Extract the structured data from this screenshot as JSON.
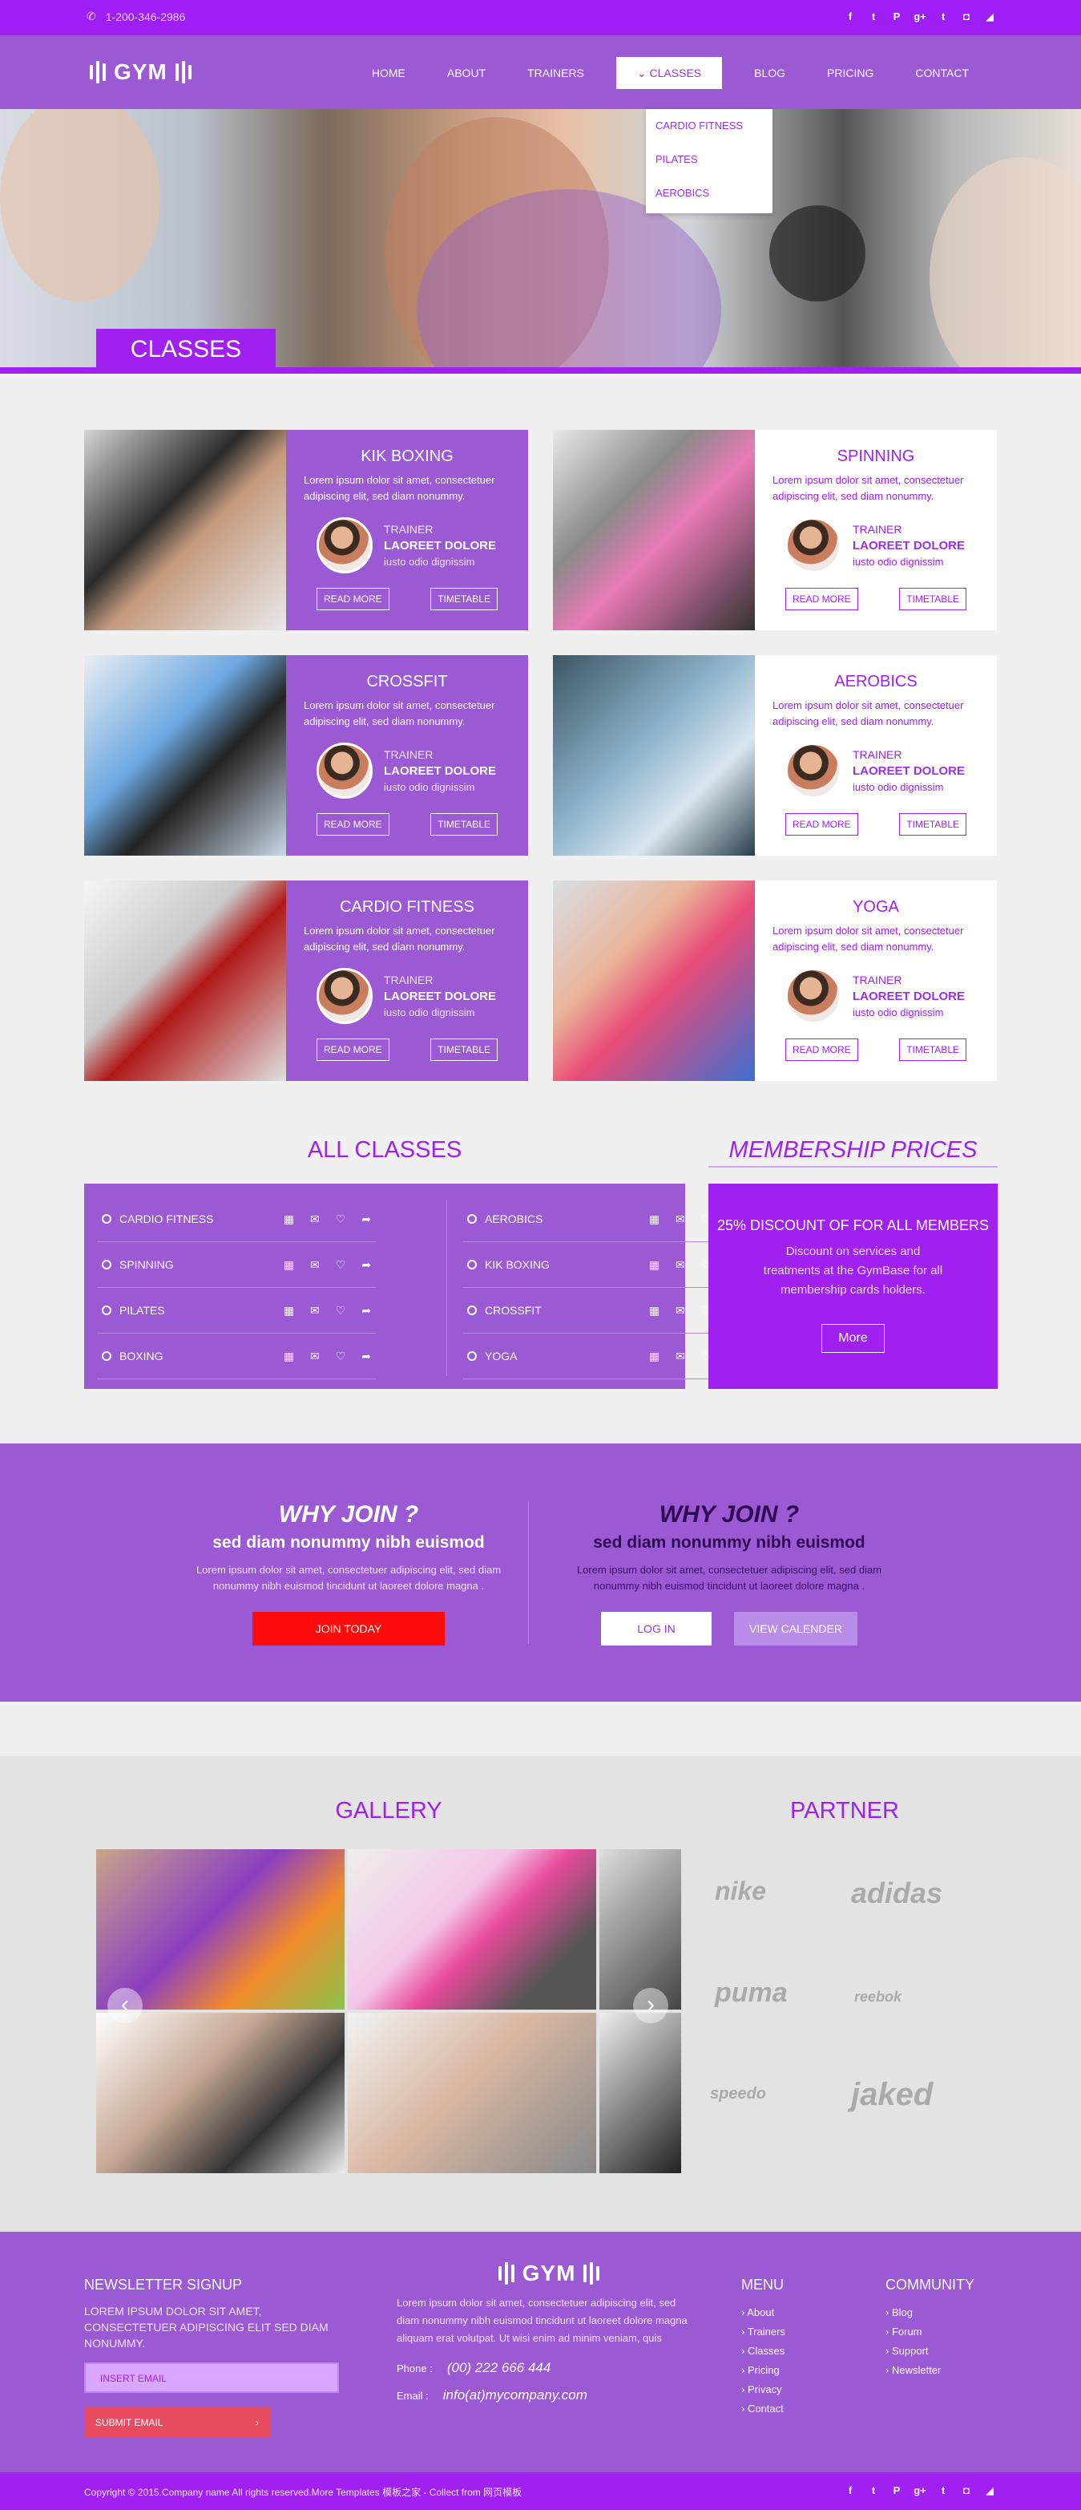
{
  "topbar": {
    "phone": "1-200-346-2986"
  },
  "social_icons": [
    "facebook-icon",
    "twitter-icon",
    "pinterest-icon",
    "google-plus-icon",
    "tumblr-icon",
    "instagram-icon",
    "rss-icon"
  ],
  "social_glyphs": [
    "f",
    "t",
    "P",
    "g+",
    "t",
    "◘",
    "◢"
  ],
  "nav": {
    "logo": "GYM",
    "items": [
      "HOME",
      "ABOUT",
      "TRAINERS",
      "CLASSES",
      "BLOG",
      "PRICING",
      "CONTACT"
    ],
    "active_index": 3
  },
  "dropdown": [
    "CARDIO FITNESS",
    "PILATES",
    "AEROBICS"
  ],
  "hero": {
    "label": "CLASSES"
  },
  "cards": [
    {
      "title": "KIK BOXING",
      "desc": "Lorem ipsum dolor sit amet, consectetuer adipiscing elit, sed diam nonummy.",
      "role": "TRAINER",
      "name": "LAOREET DOLORE",
      "sub": "iusto odio dignissim",
      "read_more": "READ MORE",
      "timetable": "TIMETABLE"
    },
    {
      "title": "SPINNING",
      "desc": "Lorem ipsum dolor sit amet, consectetuer adipiscing elit, sed diam nonummy.",
      "role": "TRAINER",
      "name": "LAOREET DOLORE",
      "sub": "iusto odio dignissim",
      "read_more": "READ MORE",
      "timetable": "TIMETABLE"
    },
    {
      "title": "CROSSFIT",
      "desc": "Lorem ipsum dolor sit amet, consectetuer adipiscing elit, sed diam nonummy.",
      "role": "TRAINER",
      "name": "LAOREET DOLORE",
      "sub": "iusto odio dignissim",
      "read_more": "READ MORE",
      "timetable": "TIMETABLE"
    },
    {
      "title": "AEROBICS",
      "desc": "Lorem ipsum dolor sit amet, consectetuer adipiscing elit, sed diam nonummy.",
      "role": "TRAINER",
      "name": "LAOREET DOLORE",
      "sub": "iusto odio dignissim",
      "read_more": "READ MORE",
      "timetable": "TIMETABLE"
    },
    {
      "title": "CARDIO FITNESS",
      "desc": "Lorem ipsum dolor sit amet, consectetuer adipiscing elit, sed diam nonummy.",
      "role": "TRAINER",
      "name": "LAOREET DOLORE",
      "sub": "iusto odio dignissim",
      "read_more": "READ MORE",
      "timetable": "TIMETABLE"
    },
    {
      "title": "YOGA",
      "desc": "Lorem ipsum dolor sit amet, consectetuer adipiscing elit, sed diam nonummy.",
      "role": "TRAINER",
      "name": "LAOREET DOLORE",
      "sub": "iusto odio dignissim",
      "read_more": "READ MORE",
      "timetable": "TIMETABLE"
    }
  ],
  "all_classes": {
    "title": "ALL CLASSES",
    "left": [
      "CARDIO FITNESS",
      "SPINNING",
      "PILATES",
      "BOXING"
    ],
    "right": [
      "AEROBICS",
      "KIK BOXING",
      "CROSSFIT",
      "YOGA"
    ]
  },
  "membership": {
    "title": "MEMBERSHIP PRICES",
    "headline": "25% DISCOUNT OF FOR ALL MEMBERS",
    "desc": "Discount on services and treatments at the GymBase for all membership cards holders.",
    "button": "More"
  },
  "why_join": {
    "left": {
      "title": "WHY JOIN ?",
      "sub": "sed diam nonummy nibh euismod",
      "text": "Lorem ipsum dolor sit amet, consectetuer adipiscing elit, sed diam nonummy nibh euismod tincidunt ut laoreet dolore magna .",
      "button": "JOIN TODAY"
    },
    "right": {
      "title": "WHY JOIN ?",
      "sub": "sed diam nonummy nibh euismod",
      "text": "Lorem ipsum dolor sit amet, consectetuer adipiscing elit, sed diam nonummy nibh euismod tincidunt ut laoreet dolore magna .",
      "button1": "LOG IN",
      "button2": "VIEW CALENDER"
    }
  },
  "gallery": {
    "title": "GALLERY"
  },
  "partner": {
    "title": "PARTNER",
    "brands": [
      "nike",
      "adidas",
      "puma",
      "reebok",
      "speedo",
      "jaked"
    ]
  },
  "footer": {
    "newsletter_title": "NEWSLETTER SIGNUP",
    "newsletter_text": "LOREM IPSUM DOLOR SIT AMET, CONSECTETUER ADIPISCING ELIT SED DIAM NONUMMY.",
    "email_placeholder": "INSERT EMAIL",
    "submit": "SUBMIT EMAIL",
    "logo": "GYM",
    "about": "Lorem ipsum dolor sit amet, consectetuer adipiscing elit, sed diam nonummy nibh euismod tincidunt ut laoreet dolore magna aliquam erat volutpat. Ut wisi enim ad minim veniam, quis",
    "phone_label": "Phone :",
    "phone": "(00) 222 666 444",
    "email_label": "Email :",
    "email": "info(at)mycompany.com",
    "menu_title": "MENU",
    "menu": [
      "About",
      "Trainers",
      "Classes",
      "Pricing",
      "Privacy",
      "Contact"
    ],
    "community_title": "COMMUNITY",
    "community": [
      "Blog",
      "Forum",
      "Support",
      "Newsletter"
    ]
  },
  "copyright": "Copyright © 2015.Company name All rights reserved.More Templates 模板之家 - Collect from 网页模板"
}
